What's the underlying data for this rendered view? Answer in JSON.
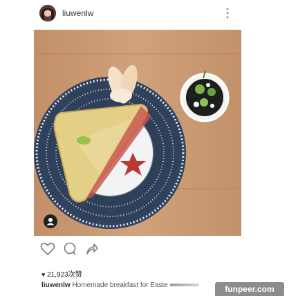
{
  "post": {
    "username": "liuwenlw",
    "likes": "21,923次赞",
    "caption_user": "liuwenlw",
    "caption_text": "Homemade breakfast for Easte"
  },
  "icons": {
    "more": "vertical-ellipsis-icon",
    "like": "heart-outline-icon",
    "comment": "speech-bubble-icon",
    "share": "share-arrow-icon",
    "tag": "user-tag-icon"
  },
  "watermark": {
    "text": "funpeer.com"
  }
}
